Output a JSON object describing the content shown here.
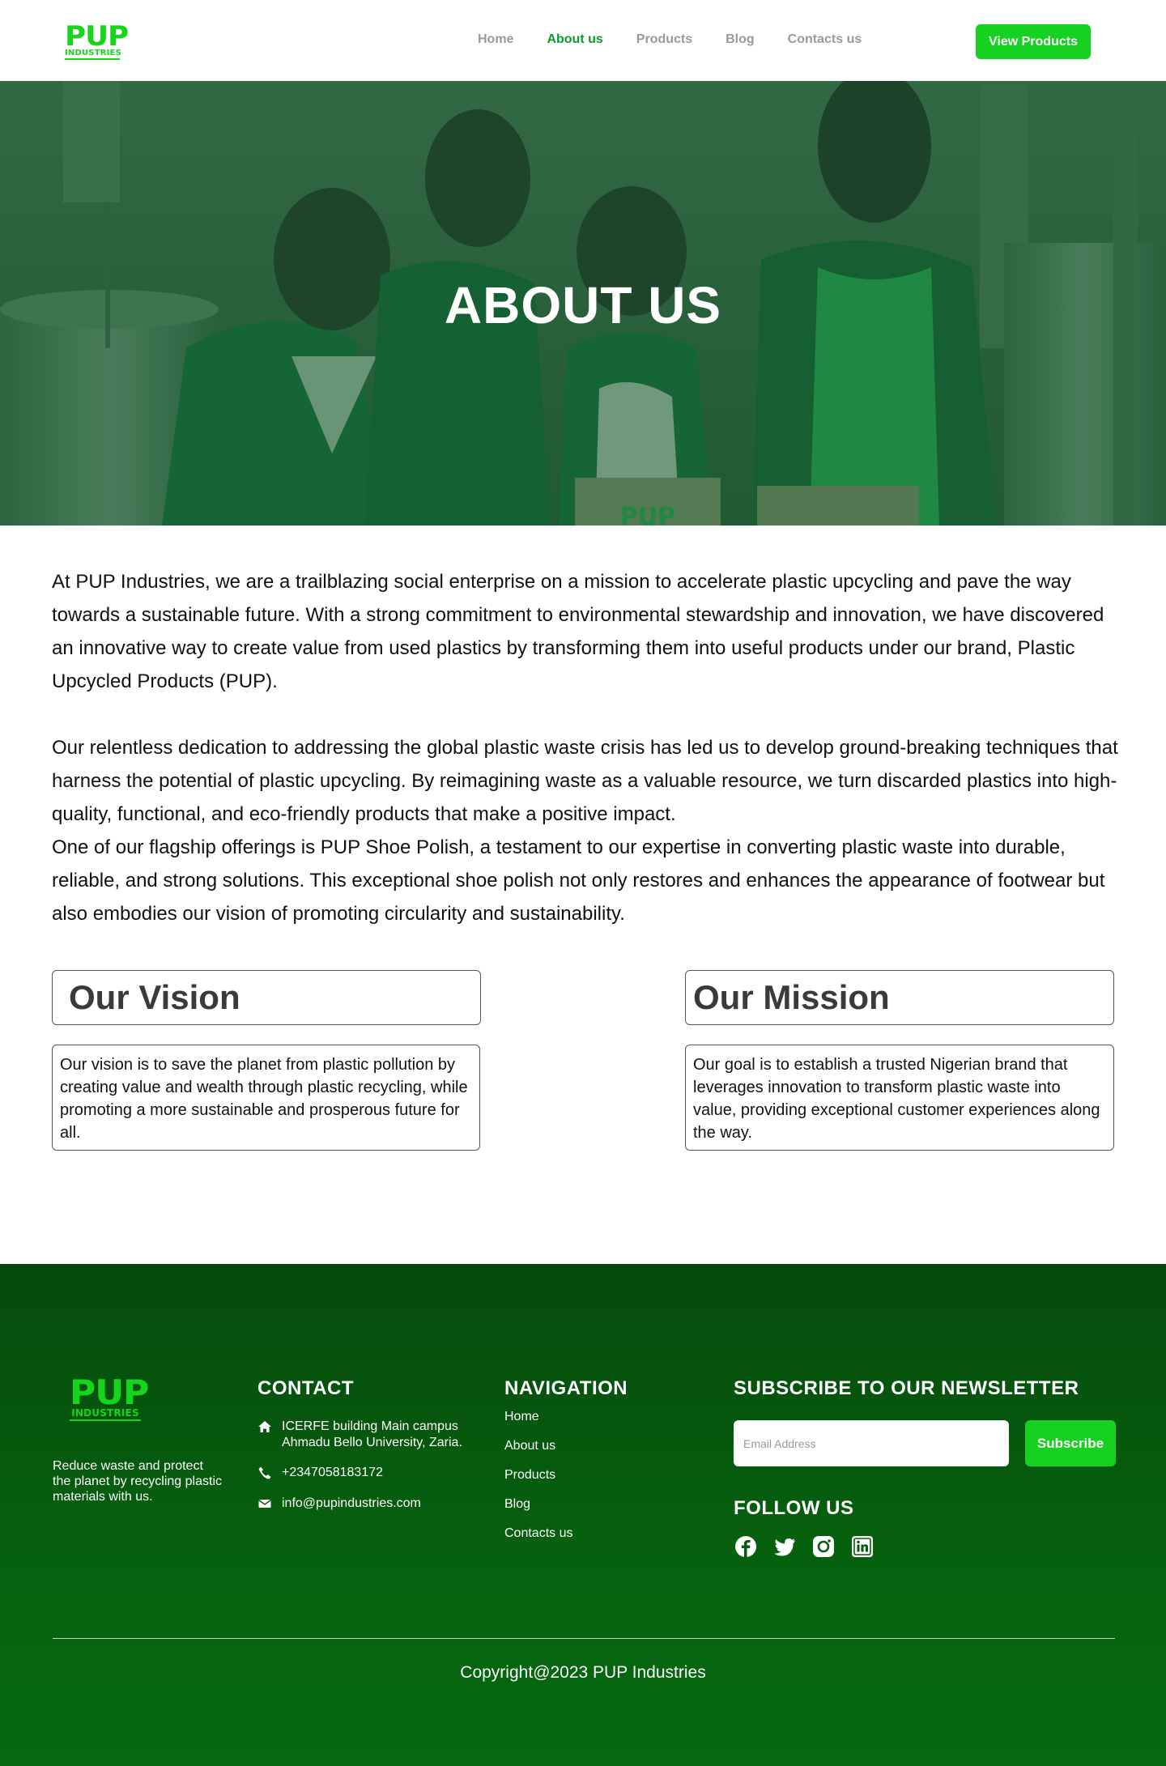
{
  "header": {
    "logo_main": "PUP",
    "logo_sub": "INDUSTRIES",
    "nav": [
      {
        "label": "Home"
      },
      {
        "label": "About us"
      },
      {
        "label": "Products"
      },
      {
        "label": "Blog"
      },
      {
        "label": "Contacts us"
      }
    ],
    "cta_label": "View Products"
  },
  "hero": {
    "title": "ABOUT US",
    "box_label": "PUP"
  },
  "intro": {
    "p1": "At PUP Industries, we are a trailblazing social enterprise on a mission to accelerate plastic upcycling and pave the way towards a sustainable future. With a strong commitment to environmental stewardship and innovation, we have discovered an innovative way to create value from used plastics by transforming them into useful products under our brand, Plastic Upcycled Products (PUP).",
    "p2": "Our relentless dedication to addressing the global plastic waste crisis has led us to develop ground-breaking techniques that harness the potential of plastic upcycling. By reimagining waste as a valuable resource, we turn discarded plastics into high-quality, functional, and eco-friendly products that make a positive impact.",
    "p3": "One of our flagship offerings is PUP Shoe Polish, a testament to our expertise in converting plastic waste into durable, reliable, and strong solutions. This exceptional shoe polish not only restores and enhances the appearance of footwear but also embodies our vision of promoting circularity and sustainability."
  },
  "vision": {
    "title": "Our Vision",
    "text": "Our vision is to save the planet from plastic pollution by creating value and wealth through plastic recycling, while promoting a more sustainable and prosperous future for all."
  },
  "mission": {
    "title": "Our Mission",
    "text": "Our goal is to establish a trusted Nigerian brand that leverages innovation to transform plastic waste into value, providing exceptional customer experiences along the way."
  },
  "footer": {
    "logo_main": "PUP",
    "logo_sub": "INDUSTRIES",
    "tagline": "Reduce waste and protect the planet by recycling plastic materials with us.",
    "contact_heading": "CONTACT",
    "address_line1": "ICERFE building Main campus",
    "address_line2": "Ahmadu Bello University, Zaria.",
    "phone": "+2347058183172",
    "email": "info@pupindustries.com",
    "nav_heading": "NAVIGATION",
    "nav": [
      {
        "label": "Home"
      },
      {
        "label": "About us"
      },
      {
        "label": "Products"
      },
      {
        "label": "Blog"
      },
      {
        "label": "Contacts us"
      }
    ],
    "newsletter_heading": "SUBSCRIBE TO OUR NEWSLETTER",
    "email_placeholder": "Email Address",
    "subscribe_label": "Subscribe",
    "follow_heading": "FOLLOW US",
    "social_icons": [
      "facebook-icon",
      "twitter-icon",
      "instagram-icon",
      "linkedin-icon"
    ],
    "copyright": "Copyright@2023 PUP Industries"
  },
  "colors": {
    "brand_green": "#16d11f",
    "active_nav": "#0d9b2a",
    "footer_green": "#054a0c"
  }
}
